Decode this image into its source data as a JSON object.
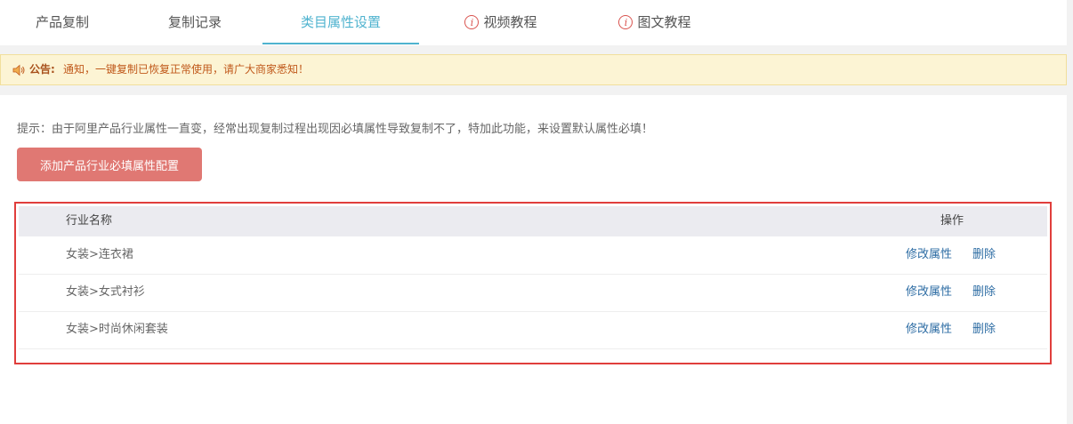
{
  "tabs": [
    {
      "label": "产品复制",
      "active": false,
      "icon": null
    },
    {
      "label": "复制记录",
      "active": false,
      "icon": null
    },
    {
      "label": "类目属性设置",
      "active": true,
      "icon": null
    },
    {
      "label": "视频教程",
      "active": false,
      "icon": "info-icon"
    },
    {
      "label": "图文教程",
      "active": false,
      "icon": "info-icon"
    }
  ],
  "notice": {
    "icon": "speaker-icon",
    "label": "公告:",
    "text": "通知，一键复制已恢复正常使用，请广大商家悉知！"
  },
  "hint": "提示：由于阿里产品行业属性一直变，经常出现复制过程出现因必填属性导致复制不了，特加此功能，来设置默认属性必填！",
  "add_button": "添加产品行业必填属性配置",
  "table": {
    "headers": {
      "name": "行业名称",
      "operation": "操作"
    },
    "rows": [
      {
        "name": "女装>连衣裙",
        "edit": "修改属性",
        "delete": "删除"
      },
      {
        "name": "女装>女式衬衫",
        "edit": "修改属性",
        "delete": "删除"
      },
      {
        "name": "女装>时尚休闲套装",
        "edit": "修改属性",
        "delete": "删除"
      }
    ]
  },
  "colors": {
    "accent": "#4fb3cf",
    "button": "#e07873",
    "link": "#2e6da4",
    "highlight_border": "#e03e3c"
  }
}
